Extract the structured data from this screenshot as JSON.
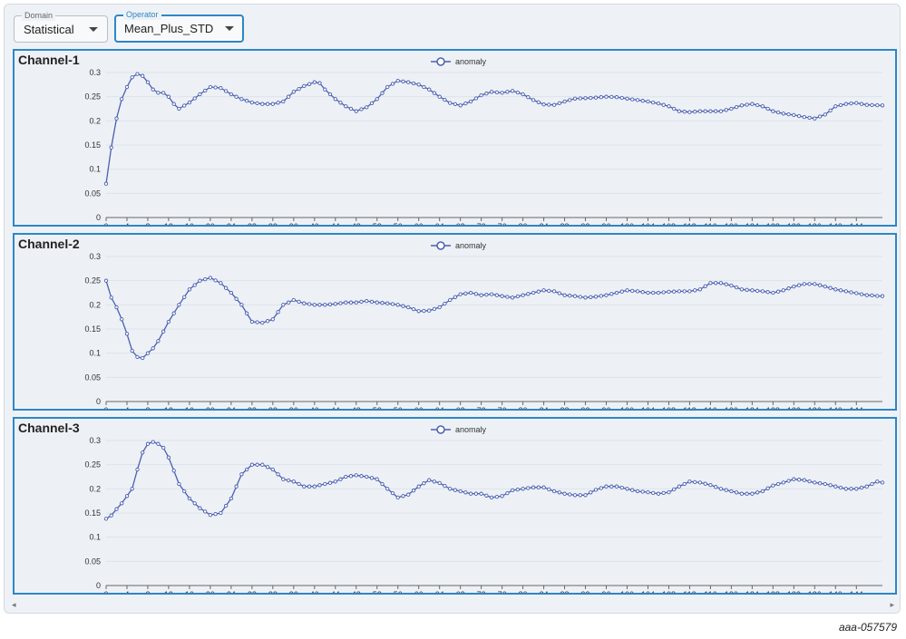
{
  "selectors": {
    "domain": {
      "label": "Domain",
      "value": "Statistical"
    },
    "operator": {
      "label": "Operator",
      "value": "Mean_Plus_STD"
    }
  },
  "footnote": "aaa-057579",
  "colors": {
    "series": "#4a5fb0",
    "panel_border": "#2f86c6"
  },
  "chart_data": [
    {
      "type": "line",
      "title": "Channel-1",
      "legend": "top-center",
      "xlim": [
        0,
        149
      ],
      "ylim": [
        0,
        0.3
      ],
      "xticks": [
        0,
        4,
        8,
        12,
        16,
        20,
        24,
        28,
        32,
        36,
        40,
        44,
        48,
        52,
        56,
        60,
        64,
        68,
        72,
        76,
        80,
        84,
        88,
        92,
        96,
        100,
        104,
        108,
        112,
        116,
        120,
        124,
        128,
        132,
        136,
        140,
        144
      ],
      "yticks": [
        0,
        0.05,
        0.1,
        0.15,
        0.2,
        0.25,
        0.3
      ],
      "series": [
        {
          "name": "anomaly",
          "keypoints": [
            [
              0,
              0.07
            ],
            [
              1,
              0.145
            ],
            [
              2,
              0.205
            ],
            [
              3,
              0.245
            ],
            [
              4,
              0.27
            ],
            [
              5,
              0.29
            ],
            [
              6,
              0.297
            ],
            [
              7,
              0.293
            ],
            [
              8,
              0.28
            ],
            [
              9,
              0.265
            ],
            [
              10,
              0.258
            ],
            [
              11,
              0.258
            ],
            [
              12,
              0.25
            ],
            [
              13,
              0.235
            ],
            [
              14,
              0.225
            ],
            [
              16,
              0.238
            ],
            [
              18,
              0.255
            ],
            [
              20,
              0.27
            ],
            [
              22,
              0.268
            ],
            [
              24,
              0.255
            ],
            [
              26,
              0.245
            ],
            [
              28,
              0.238
            ],
            [
              30,
              0.235
            ],
            [
              32,
              0.235
            ],
            [
              34,
              0.24
            ],
            [
              36,
              0.26
            ],
            [
              38,
              0.272
            ],
            [
              40,
              0.28
            ],
            [
              41,
              0.278
            ],
            [
              42,
              0.265
            ],
            [
              44,
              0.245
            ],
            [
              46,
              0.23
            ],
            [
              48,
              0.22
            ],
            [
              50,
              0.228
            ],
            [
              52,
              0.245
            ],
            [
              54,
              0.27
            ],
            [
              56,
              0.283
            ],
            [
              58,
              0.28
            ],
            [
              60,
              0.275
            ],
            [
              62,
              0.265
            ],
            [
              64,
              0.25
            ],
            [
              66,
              0.237
            ],
            [
              68,
              0.232
            ],
            [
              70,
              0.24
            ],
            [
              72,
              0.253
            ],
            [
              74,
              0.26
            ],
            [
              76,
              0.258
            ],
            [
              78,
              0.262
            ],
            [
              80,
              0.255
            ],
            [
              82,
              0.243
            ],
            [
              84,
              0.234
            ],
            [
              86,
              0.233
            ],
            [
              88,
              0.24
            ],
            [
              90,
              0.246
            ],
            [
              92,
              0.247
            ],
            [
              94,
              0.248
            ],
            [
              96,
              0.25
            ],
            [
              98,
              0.249
            ],
            [
              100,
              0.246
            ],
            [
              102,
              0.243
            ],
            [
              104,
              0.24
            ],
            [
              106,
              0.236
            ],
            [
              108,
              0.23
            ],
            [
              110,
              0.22
            ],
            [
              112,
              0.218
            ],
            [
              114,
              0.22
            ],
            [
              116,
              0.22
            ],
            [
              118,
              0.22
            ],
            [
              120,
              0.225
            ],
            [
              122,
              0.232
            ],
            [
              124,
              0.235
            ],
            [
              126,
              0.23
            ],
            [
              128,
              0.22
            ],
            [
              130,
              0.215
            ],
            [
              132,
              0.212
            ],
            [
              134,
              0.208
            ],
            [
              136,
              0.205
            ],
            [
              138,
              0.213
            ],
            [
              140,
              0.23
            ],
            [
              142,
              0.235
            ],
            [
              144,
              0.237
            ],
            [
              146,
              0.233
            ],
            [
              149,
              0.232
            ]
          ]
        }
      ]
    },
    {
      "type": "line",
      "title": "Channel-2",
      "legend": "top-center",
      "xlim": [
        0,
        149
      ],
      "ylim": [
        0,
        0.3
      ],
      "xticks": [
        0,
        4,
        8,
        12,
        16,
        20,
        24,
        28,
        32,
        36,
        40,
        44,
        48,
        52,
        56,
        60,
        64,
        68,
        72,
        76,
        80,
        84,
        88,
        92,
        96,
        100,
        104,
        108,
        112,
        116,
        120,
        124,
        128,
        132,
        136,
        140,
        144
      ],
      "yticks": [
        0,
        0.05,
        0.1,
        0.15,
        0.2,
        0.25,
        0.3
      ],
      "series": [
        {
          "name": "anomaly",
          "keypoints": [
            [
              0,
              0.25
            ],
            [
              1,
              0.215
            ],
            [
              2,
              0.195
            ],
            [
              3,
              0.17
            ],
            [
              4,
              0.14
            ],
            [
              5,
              0.105
            ],
            [
              6,
              0.092
            ],
            [
              7,
              0.09
            ],
            [
              8,
              0.1
            ],
            [
              9,
              0.11
            ],
            [
              10,
              0.125
            ],
            [
              12,
              0.165
            ],
            [
              14,
              0.2
            ],
            [
              16,
              0.232
            ],
            [
              18,
              0.25
            ],
            [
              20,
              0.256
            ],
            [
              22,
              0.245
            ],
            [
              24,
              0.225
            ],
            [
              26,
              0.2
            ],
            [
              28,
              0.165
            ],
            [
              30,
              0.163
            ],
            [
              32,
              0.17
            ],
            [
              34,
              0.2
            ],
            [
              36,
              0.21
            ],
            [
              38,
              0.203
            ],
            [
              40,
              0.2
            ],
            [
              42,
              0.2
            ],
            [
              44,
              0.202
            ],
            [
              46,
              0.205
            ],
            [
              48,
              0.205
            ],
            [
              50,
              0.208
            ],
            [
              52,
              0.205
            ],
            [
              54,
              0.203
            ],
            [
              56,
              0.2
            ],
            [
              58,
              0.195
            ],
            [
              60,
              0.187
            ],
            [
              62,
              0.188
            ],
            [
              64,
              0.195
            ],
            [
              66,
              0.21
            ],
            [
              68,
              0.222
            ],
            [
              70,
              0.225
            ],
            [
              72,
              0.22
            ],
            [
              74,
              0.222
            ],
            [
              76,
              0.218
            ],
            [
              78,
              0.215
            ],
            [
              80,
              0.22
            ],
            [
              82,
              0.225
            ],
            [
              84,
              0.23
            ],
            [
              86,
              0.228
            ],
            [
              88,
              0.22
            ],
            [
              90,
              0.218
            ],
            [
              92,
              0.215
            ],
            [
              94,
              0.217
            ],
            [
              96,
              0.22
            ],
            [
              98,
              0.225
            ],
            [
              100,
              0.23
            ],
            [
              102,
              0.228
            ],
            [
              104,
              0.225
            ],
            [
              106,
              0.225
            ],
            [
              108,
              0.227
            ],
            [
              110,
              0.228
            ],
            [
              112,
              0.228
            ],
            [
              114,
              0.232
            ],
            [
              116,
              0.245
            ],
            [
              118,
              0.245
            ],
            [
              120,
              0.24
            ],
            [
              122,
              0.232
            ],
            [
              124,
              0.23
            ],
            [
              126,
              0.228
            ],
            [
              128,
              0.225
            ],
            [
              130,
              0.23
            ],
            [
              132,
              0.238
            ],
            [
              134,
              0.243
            ],
            [
              136,
              0.243
            ],
            [
              138,
              0.238
            ],
            [
              140,
              0.232
            ],
            [
              142,
              0.228
            ],
            [
              144,
              0.224
            ],
            [
              146,
              0.22
            ],
            [
              149,
              0.218
            ]
          ]
        }
      ]
    },
    {
      "type": "line",
      "title": "Channel-3",
      "legend": "top-center",
      "xlim": [
        0,
        149
      ],
      "ylim": [
        0,
        0.3
      ],
      "xticks": [
        0,
        4,
        8,
        12,
        16,
        20,
        24,
        28,
        32,
        36,
        40,
        44,
        48,
        52,
        56,
        60,
        64,
        68,
        72,
        76,
        80,
        84,
        88,
        92,
        96,
        100,
        104,
        108,
        112,
        116,
        120,
        124,
        128,
        132,
        136,
        140,
        144
      ],
      "yticks": [
        0,
        0.05,
        0.1,
        0.15,
        0.2,
        0.25,
        0.3
      ],
      "series": [
        {
          "name": "anomaly",
          "keypoints": [
            [
              0,
              0.138
            ],
            [
              1,
              0.145
            ],
            [
              2,
              0.158
            ],
            [
              3,
              0.17
            ],
            [
              4,
              0.185
            ],
            [
              5,
              0.2
            ],
            [
              6,
              0.24
            ],
            [
              7,
              0.275
            ],
            [
              8,
              0.293
            ],
            [
              9,
              0.297
            ],
            [
              10,
              0.293
            ],
            [
              11,
              0.285
            ],
            [
              12,
              0.265
            ],
            [
              14,
              0.21
            ],
            [
              16,
              0.18
            ],
            [
              18,
              0.16
            ],
            [
              20,
              0.146
            ],
            [
              22,
              0.15
            ],
            [
              24,
              0.18
            ],
            [
              26,
              0.23
            ],
            [
              28,
              0.25
            ],
            [
              30,
              0.25
            ],
            [
              32,
              0.24
            ],
            [
              34,
              0.22
            ],
            [
              36,
              0.215
            ],
            [
              38,
              0.205
            ],
            [
              40,
              0.205
            ],
            [
              42,
              0.21
            ],
            [
              44,
              0.215
            ],
            [
              46,
              0.225
            ],
            [
              48,
              0.228
            ],
            [
              50,
              0.225
            ],
            [
              52,
              0.22
            ],
            [
              54,
              0.2
            ],
            [
              56,
              0.182
            ],
            [
              58,
              0.188
            ],
            [
              60,
              0.205
            ],
            [
              62,
              0.218
            ],
            [
              64,
              0.212
            ],
            [
              66,
              0.2
            ],
            [
              68,
              0.195
            ],
            [
              70,
              0.19
            ],
            [
              72,
              0.19
            ],
            [
              74,
              0.182
            ],
            [
              76,
              0.185
            ],
            [
              78,
              0.197
            ],
            [
              80,
              0.2
            ],
            [
              82,
              0.203
            ],
            [
              84,
              0.203
            ],
            [
              86,
              0.195
            ],
            [
              88,
              0.19
            ],
            [
              90,
              0.187
            ],
            [
              92,
              0.187
            ],
            [
              94,
              0.198
            ],
            [
              96,
              0.205
            ],
            [
              98,
              0.205
            ],
            [
              100,
              0.2
            ],
            [
              102,
              0.195
            ],
            [
              104,
              0.193
            ],
            [
              106,
              0.19
            ],
            [
              108,
              0.193
            ],
            [
              110,
              0.205
            ],
            [
              112,
              0.215
            ],
            [
              114,
              0.213
            ],
            [
              116,
              0.208
            ],
            [
              118,
              0.2
            ],
            [
              120,
              0.195
            ],
            [
              122,
              0.19
            ],
            [
              124,
              0.19
            ],
            [
              126,
              0.195
            ],
            [
              128,
              0.207
            ],
            [
              130,
              0.213
            ],
            [
              132,
              0.22
            ],
            [
              134,
              0.218
            ],
            [
              136,
              0.213
            ],
            [
              138,
              0.21
            ],
            [
              140,
              0.205
            ],
            [
              142,
              0.2
            ],
            [
              144,
              0.2
            ],
            [
              146,
              0.205
            ],
            [
              148,
              0.215
            ],
            [
              149,
              0.213
            ]
          ]
        }
      ]
    }
  ]
}
